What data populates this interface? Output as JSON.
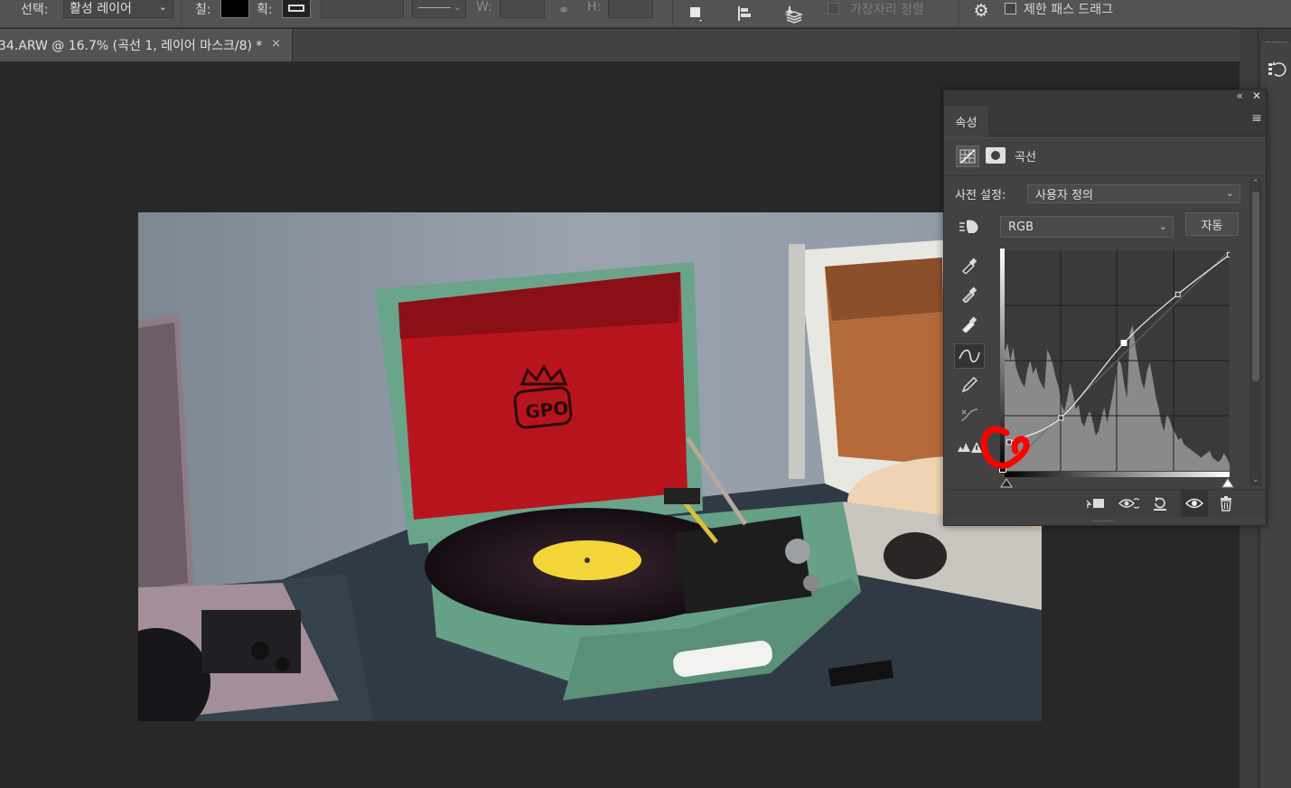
{
  "options_bar": {
    "select_label": "선택:",
    "select_value": "활성 레이어",
    "fill_label": "칠:",
    "stroke_label": "획:",
    "w_label": "W:",
    "h_label": "H:",
    "align_edges_label": "가장자리 정렬",
    "constrain_path_label": "제한 패스 드래그"
  },
  "document_tab": {
    "title": "34.ARW @ 16.7% (곡선 1, 레이어 마스크/8) *",
    "close": "×"
  },
  "properties_panel": {
    "tab": "속성",
    "adjustment_name": "곡선",
    "preset_label": "사전 설정:",
    "preset_value": "사용자 정의",
    "channel_value": "RGB",
    "auto_button": "자동"
  },
  "curve_points": [
    [
      0.02,
      0.13
    ],
    [
      0.25,
      0.24
    ],
    [
      0.53,
      0.58
    ],
    [
      0.77,
      0.8
    ],
    [
      1.0,
      0.98
    ]
  ],
  "histogram": [
    0.54,
    0.58,
    0.5,
    0.56,
    0.47,
    0.43,
    0.4,
    0.38,
    0.46,
    0.5,
    0.44,
    0.47,
    0.42,
    0.39,
    0.37,
    0.55,
    0.52,
    0.48,
    0.42,
    0.38,
    0.3,
    0.27,
    0.33,
    0.4,
    0.35,
    0.28,
    0.3,
    0.22,
    0.2,
    0.25,
    0.27,
    0.22,
    0.16,
    0.18,
    0.24,
    0.29,
    0.22,
    0.28,
    0.35,
    0.43,
    0.51,
    0.48,
    0.39,
    0.33,
    0.63,
    0.66,
    0.56,
    0.48,
    0.41,
    0.37,
    0.45,
    0.49,
    0.42,
    0.34,
    0.29,
    0.22,
    0.18,
    0.26,
    0.23,
    0.19,
    0.17,
    0.14,
    0.15,
    0.12,
    0.11,
    0.1,
    0.09,
    0.08,
    0.07,
    0.06,
    0.07,
    0.08,
    0.09,
    0.06,
    0.05,
    0.04,
    0.05,
    0.08,
    0.06,
    0.03
  ],
  "colors": {
    "annotation_red": "#ff0000",
    "record_red": "#b8141e",
    "case_green": "#68a38a",
    "label_yellow": "#f3d53a"
  }
}
